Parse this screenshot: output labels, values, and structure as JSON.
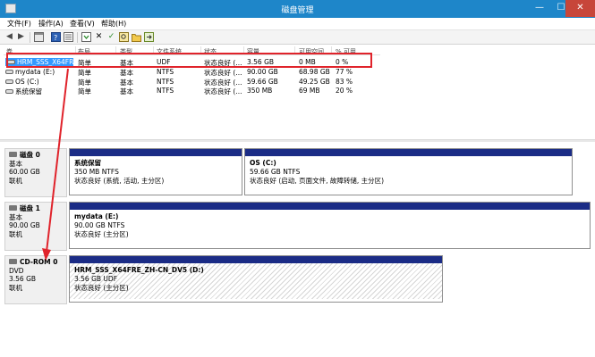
{
  "window": {
    "title": "磁盘管理",
    "min_glyph": "—",
    "max_glyph": "☐",
    "close_glyph": "✕"
  },
  "menu": {
    "items": [
      "文件(F)",
      "操作(A)",
      "查看(V)",
      "帮助(H)"
    ]
  },
  "toolbar": {
    "icons": [
      "back-arrow-icon",
      "forward-arrow-icon",
      "console-tree-icon",
      "help-icon",
      "properties-icon",
      "refresh-icon",
      "delete-icon",
      "check-icon",
      "search-icon",
      "folder-icon",
      "import-icon"
    ]
  },
  "volume_list": {
    "columns": [
      "卷",
      "布局",
      "类型",
      "文件系统",
      "状态",
      "容量",
      "可用空间",
      "% 可用"
    ],
    "rows": [
      [
        "HRM_SSS_X64FR...",
        "简单",
        "基本",
        "UDF",
        "状态良好 (...",
        "3.56 GB",
        "0 MB",
        "0 %"
      ],
      [
        "mydata (E:)",
        "简单",
        "基本",
        "NTFS",
        "状态良好 (...",
        "90.00 GB",
        "68.98 GB",
        "77 %"
      ],
      [
        "OS (C:)",
        "简单",
        "基本",
        "NTFS",
        "状态良好 (...",
        "59.66 GB",
        "49.25 GB",
        "83 %"
      ],
      [
        "系统保留",
        "简单",
        "基本",
        "NTFS",
        "状态良好 (...",
        "350 MB",
        "69 MB",
        "20 %"
      ]
    ]
  },
  "disks": [
    {
      "name": "磁盘 0",
      "type": "基本",
      "size": "60.00 GB",
      "status": "联机",
      "partitions": [
        {
          "name": "系统保留",
          "size": "350 MB NTFS",
          "status": "状态良好 (系统, 活动, 主分区)"
        },
        {
          "name": "OS  (C:)",
          "size": "59.66 GB NTFS",
          "status": "状态良好 (启动, 页面文件, 故障转储, 主分区)"
        }
      ]
    },
    {
      "name": "磁盘 1",
      "type": "基本",
      "size": "90.00 GB",
      "status": "联机",
      "partitions": [
        {
          "name": "mydata  (E:)",
          "size": "90.00 GB NTFS",
          "status": "状态良好 (主分区)"
        }
      ]
    },
    {
      "name": "CD-ROM 0",
      "type": "DVD",
      "size": "3.56 GB",
      "status": "联机",
      "partitions": [
        {
          "name": "HRM_SSS_X64FRE_ZH-CN_DV5  (D:)",
          "size": "3.56 GB UDF",
          "status": "状态良好 (主分区)"
        }
      ]
    }
  ],
  "colors": {
    "titlebar": "#1e86c9",
    "partition_bar": "#1b2c86",
    "annotation": "#e0232b",
    "selection": "#3399ff"
  }
}
